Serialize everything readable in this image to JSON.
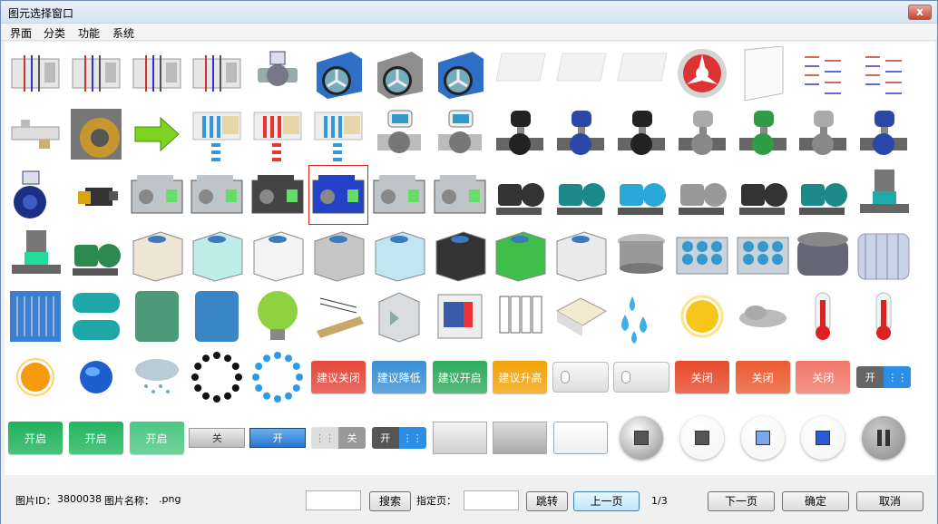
{
  "window": {
    "title": "图元选择窗口",
    "close_glyph": "x"
  },
  "menu": [
    "界面",
    "分类",
    "功能",
    "系统"
  ],
  "rows": [
    [
      "valve-panel-1",
      "valve-panel-2",
      "valve-panel-3",
      "valve-panel-4",
      "gate-valve",
      "axial-fan-blue",
      "axial-fan-gray",
      "axial-fan-blue-2",
      "panel-slant-1",
      "panel-slant-2",
      "panel-slant-3",
      "round-fan-red",
      "panel-flat",
      "pipe-legend-1",
      "pipe-legend-2"
    ],
    [
      "pipe-assembly",
      "gear-wheel",
      "arrow-right-green",
      "coil-blue",
      "coil-red",
      "coil-blue-2",
      "flow-meter",
      "flow-meter-2",
      "electric-valve-black",
      "electric-valve-blue",
      "electric-valve-3way",
      "electric-valve-gray",
      "electric-valve-green",
      "manual-valve-gray",
      "manual-valve-blue"
    ],
    [
      "butterfly-valve",
      "motor-yellow",
      "chiller-1",
      "chiller-2",
      "centrifugal-chiller",
      "centrifugal-chiller-blue",
      "chiller-3",
      "chiller-4",
      "pump-black",
      "pump-teal",
      "pump-blue-gray",
      "pump-green-gray",
      "pump-black-2",
      "pump-teal-2",
      "inline-pump"
    ],
    [
      "inline-pump-2",
      "pump-green",
      "cooling-tower-beige",
      "cooling-tower-cyan",
      "cooling-tower-white",
      "cooling-tower-gray",
      "cooling-tower-lightblue",
      "cooling-tower-black",
      "cooling-tower-green",
      "cooling-tower-white-2",
      "cooling-tower-round",
      "air-cooled-unit",
      "air-cooled-unit-2",
      "tank-gray",
      "tank-glass"
    ],
    [
      "plate-exchanger",
      "dual-tank",
      "tank-green",
      "tank-blue",
      "bulb-green",
      "power-line",
      "elevator",
      "server-rack",
      "data-center",
      "room-plan",
      "water-drops",
      "sun",
      "cloud",
      "thermometer",
      "thermometer-2"
    ],
    [
      "sun-orange",
      "globe-blue",
      "snow-cloud",
      "spinner-black",
      "spinner-blue",
      "pill-red",
      "pill-blue",
      "pill-green",
      "pill-orange",
      "slider-off",
      "slider-on",
      "off-red",
      "off-red-2",
      "off-red-3",
      "toggle-on-dark"
    ],
    [
      "on-green",
      "on-green-2",
      "on-green-3",
      "bar-off",
      "bar-on",
      "toggle-off-gray",
      "toggle-on-gray",
      "plain-gray",
      "plain-gray-2",
      "plain-white",
      "round-stop",
      "round-stop-2",
      "round-stop-3",
      "round-stop-4",
      "round-pause"
    ]
  ],
  "buttons": {
    "suggest_off": "建议关闭",
    "suggest_lower": "建议降低",
    "suggest_on": "建议开启",
    "suggest_raise": "建议升高",
    "off": "关闭",
    "off_short": "关",
    "on": "开",
    "on_long": "开启"
  },
  "colors": {
    "red": "#e4473a",
    "blue": "#3a8fd4",
    "green": "#2eab5c",
    "orange": "#f2a20c",
    "offred": "#e65a3c"
  },
  "bottom": {
    "pic_id_label": "图片ID：",
    "pic_id_value": "3800038",
    "pic_name_label": "图片名称：",
    "pic_name_value": ".png",
    "search_value": "",
    "search_btn": "搜索",
    "page_label": "指定页：",
    "page_value": "",
    "goto_btn": "跳转",
    "prev_btn": "上一页",
    "page_info": "1/3",
    "next_btn": "下一页",
    "ok_btn": "确定",
    "cancel_btn": "取消"
  }
}
